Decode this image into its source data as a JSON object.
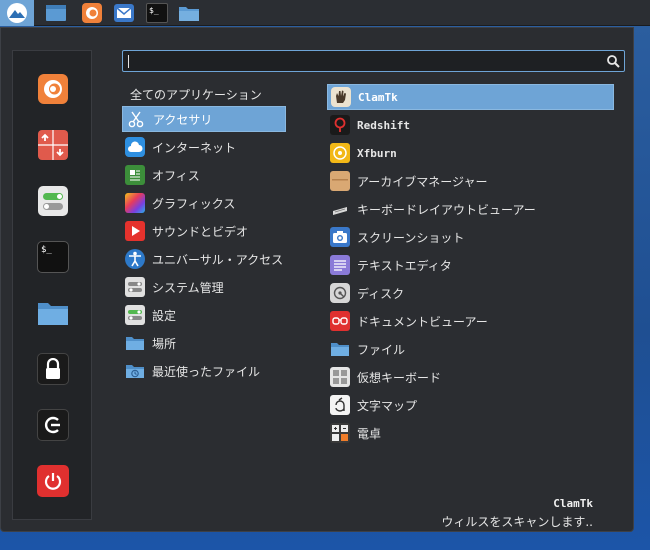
{
  "panel": {
    "terminal_glyph": "$_"
  },
  "sidebar": {
    "terminal_glyph": "$_"
  },
  "search": {
    "value": "",
    "placeholder": ""
  },
  "categories": {
    "header": "全てのアプリケーション",
    "items": [
      {
        "label": "アクセサリ",
        "icon": "scissors-icon"
      },
      {
        "label": "インターネット",
        "icon": "cloud-icon"
      },
      {
        "label": "オフィス",
        "icon": "office-icon"
      },
      {
        "label": "グラフィックス",
        "icon": "graphics-icon"
      },
      {
        "label": "サウンドとビデオ",
        "icon": "play-icon"
      },
      {
        "label": "ユニバーサル・アクセス",
        "icon": "accessibility-icon"
      },
      {
        "label": "システム管理",
        "icon": "system-settings-icon"
      },
      {
        "label": "設定",
        "icon": "settings-toggle-icon"
      },
      {
        "label": "場所",
        "icon": "folder-icon"
      },
      {
        "label": "最近使ったファイル",
        "icon": "recent-folder-icon"
      }
    ]
  },
  "apps": {
    "items": [
      {
        "label": "ClamTk",
        "icon": "clamtk-hand-icon"
      },
      {
        "label": "Redshift",
        "icon": "redshift-bulb-icon"
      },
      {
        "label": "Xfburn",
        "icon": "disc-burner-icon"
      },
      {
        "label": "アーカイブマネージャー",
        "icon": "archive-box-icon"
      },
      {
        "label": "キーボードレイアウトビューアー",
        "icon": "keyboard-icon"
      },
      {
        "label": "スクリーンショット",
        "icon": "camera-icon"
      },
      {
        "label": "テキストエディタ",
        "icon": "text-editor-icon"
      },
      {
        "label": "ディスク",
        "icon": "disk-icon"
      },
      {
        "label": "ドキュメントビューアー",
        "icon": "glasses-icon"
      },
      {
        "label": "ファイル",
        "icon": "folder-icon"
      },
      {
        "label": "仮想キーボード",
        "icon": "virtual-keyboard-icon"
      },
      {
        "label": "文字マップ",
        "icon": "character-map-icon"
      },
      {
        "label": "電卓",
        "icon": "calculator-icon"
      }
    ]
  },
  "description": {
    "title": "ClamTk",
    "text": "ウィルスをスキャンします.."
  },
  "colors": {
    "accent": "#6ea4d6",
    "menu_bg": "#2b2d31",
    "sidebar_bg": "#222427"
  }
}
